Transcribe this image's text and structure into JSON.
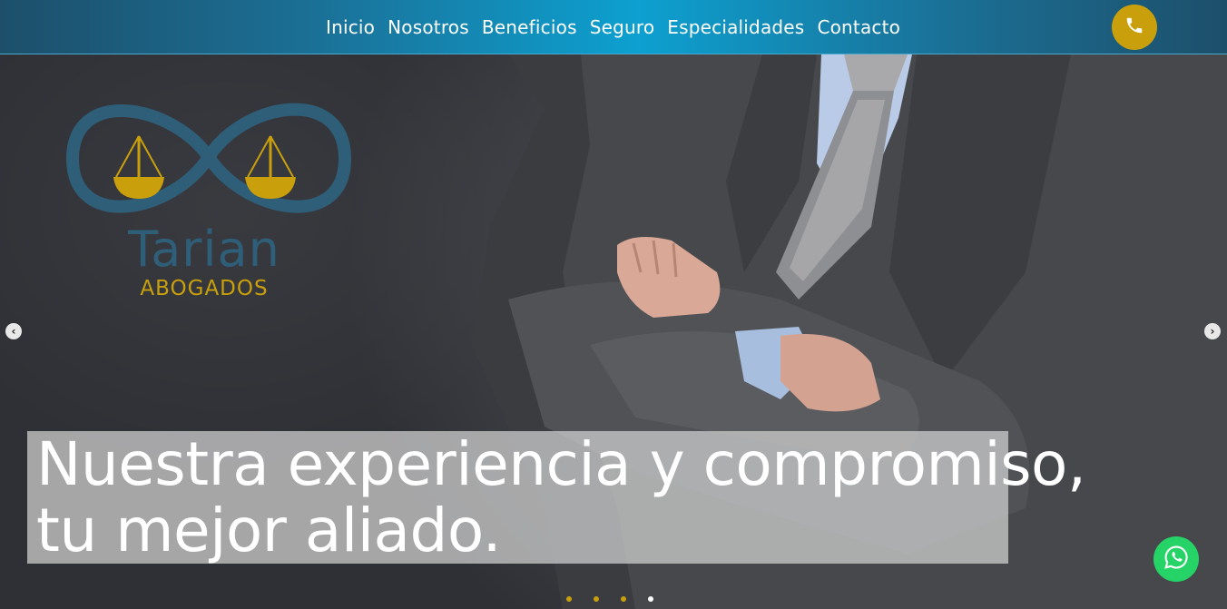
{
  "nav": {
    "items": [
      "Inicio",
      "Nosotros",
      "Beneficios",
      "Seguro",
      "Especialidades",
      "Contacto"
    ]
  },
  "header": {
    "phone_icon": "phone-icon"
  },
  "logo": {
    "name": "Tarian",
    "subtitle": "ABOGADOS"
  },
  "slider": {
    "headline_line1": "Nuestra experiencia y compromiso,",
    "headline_line2": "tu mejor aliado.",
    "prev_icon": "chevron-left-icon",
    "next_icon": "chevron-right-icon",
    "prev_glyph": "‹",
    "next_glyph": "›",
    "slide_count": 4,
    "active_slide": 4
  },
  "colors": {
    "accent_gold": "#c9a00c",
    "logo_blue": "#2f5e78",
    "nav_highlight": "#0da0d0",
    "whatsapp_green": "#25d366",
    "dot_inactive": "#c9a00c",
    "dot_active": "#ffffff"
  },
  "floating": {
    "whatsapp_icon": "whatsapp-icon"
  }
}
